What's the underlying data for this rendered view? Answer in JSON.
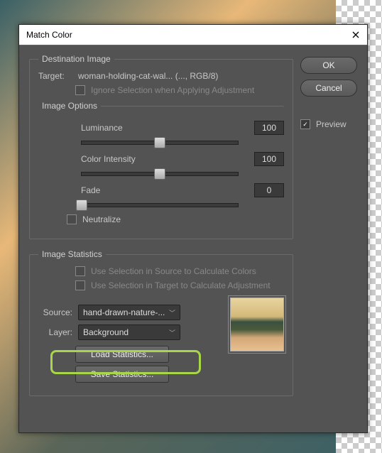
{
  "title": "Match Color",
  "dest": {
    "legend": "Destination Image",
    "target_lbl": "Target:",
    "target_val": "woman-holding-cat-wal... (..., RGB/8)",
    "ignore": "Ignore Selection when Applying Adjustment",
    "options_legend": "Image Options",
    "luminance_lbl": "Luminance",
    "luminance_val": "100",
    "intensity_lbl": "Color Intensity",
    "intensity_val": "100",
    "fade_lbl": "Fade",
    "fade_val": "0",
    "neutralize": "Neutralize"
  },
  "stats": {
    "legend": "Image Statistics",
    "use_src": "Use Selection in Source to Calculate Colors",
    "use_tgt": "Use Selection in Target to Calculate Adjustment",
    "source_lbl": "Source:",
    "source_val": "hand-drawn-nature-...",
    "layer_lbl": "Layer:",
    "layer_val": "Background",
    "load": "Load Statistics...",
    "save": "Save Statistics..."
  },
  "buttons": {
    "ok": "OK",
    "cancel": "Cancel",
    "preview": "Preview"
  }
}
